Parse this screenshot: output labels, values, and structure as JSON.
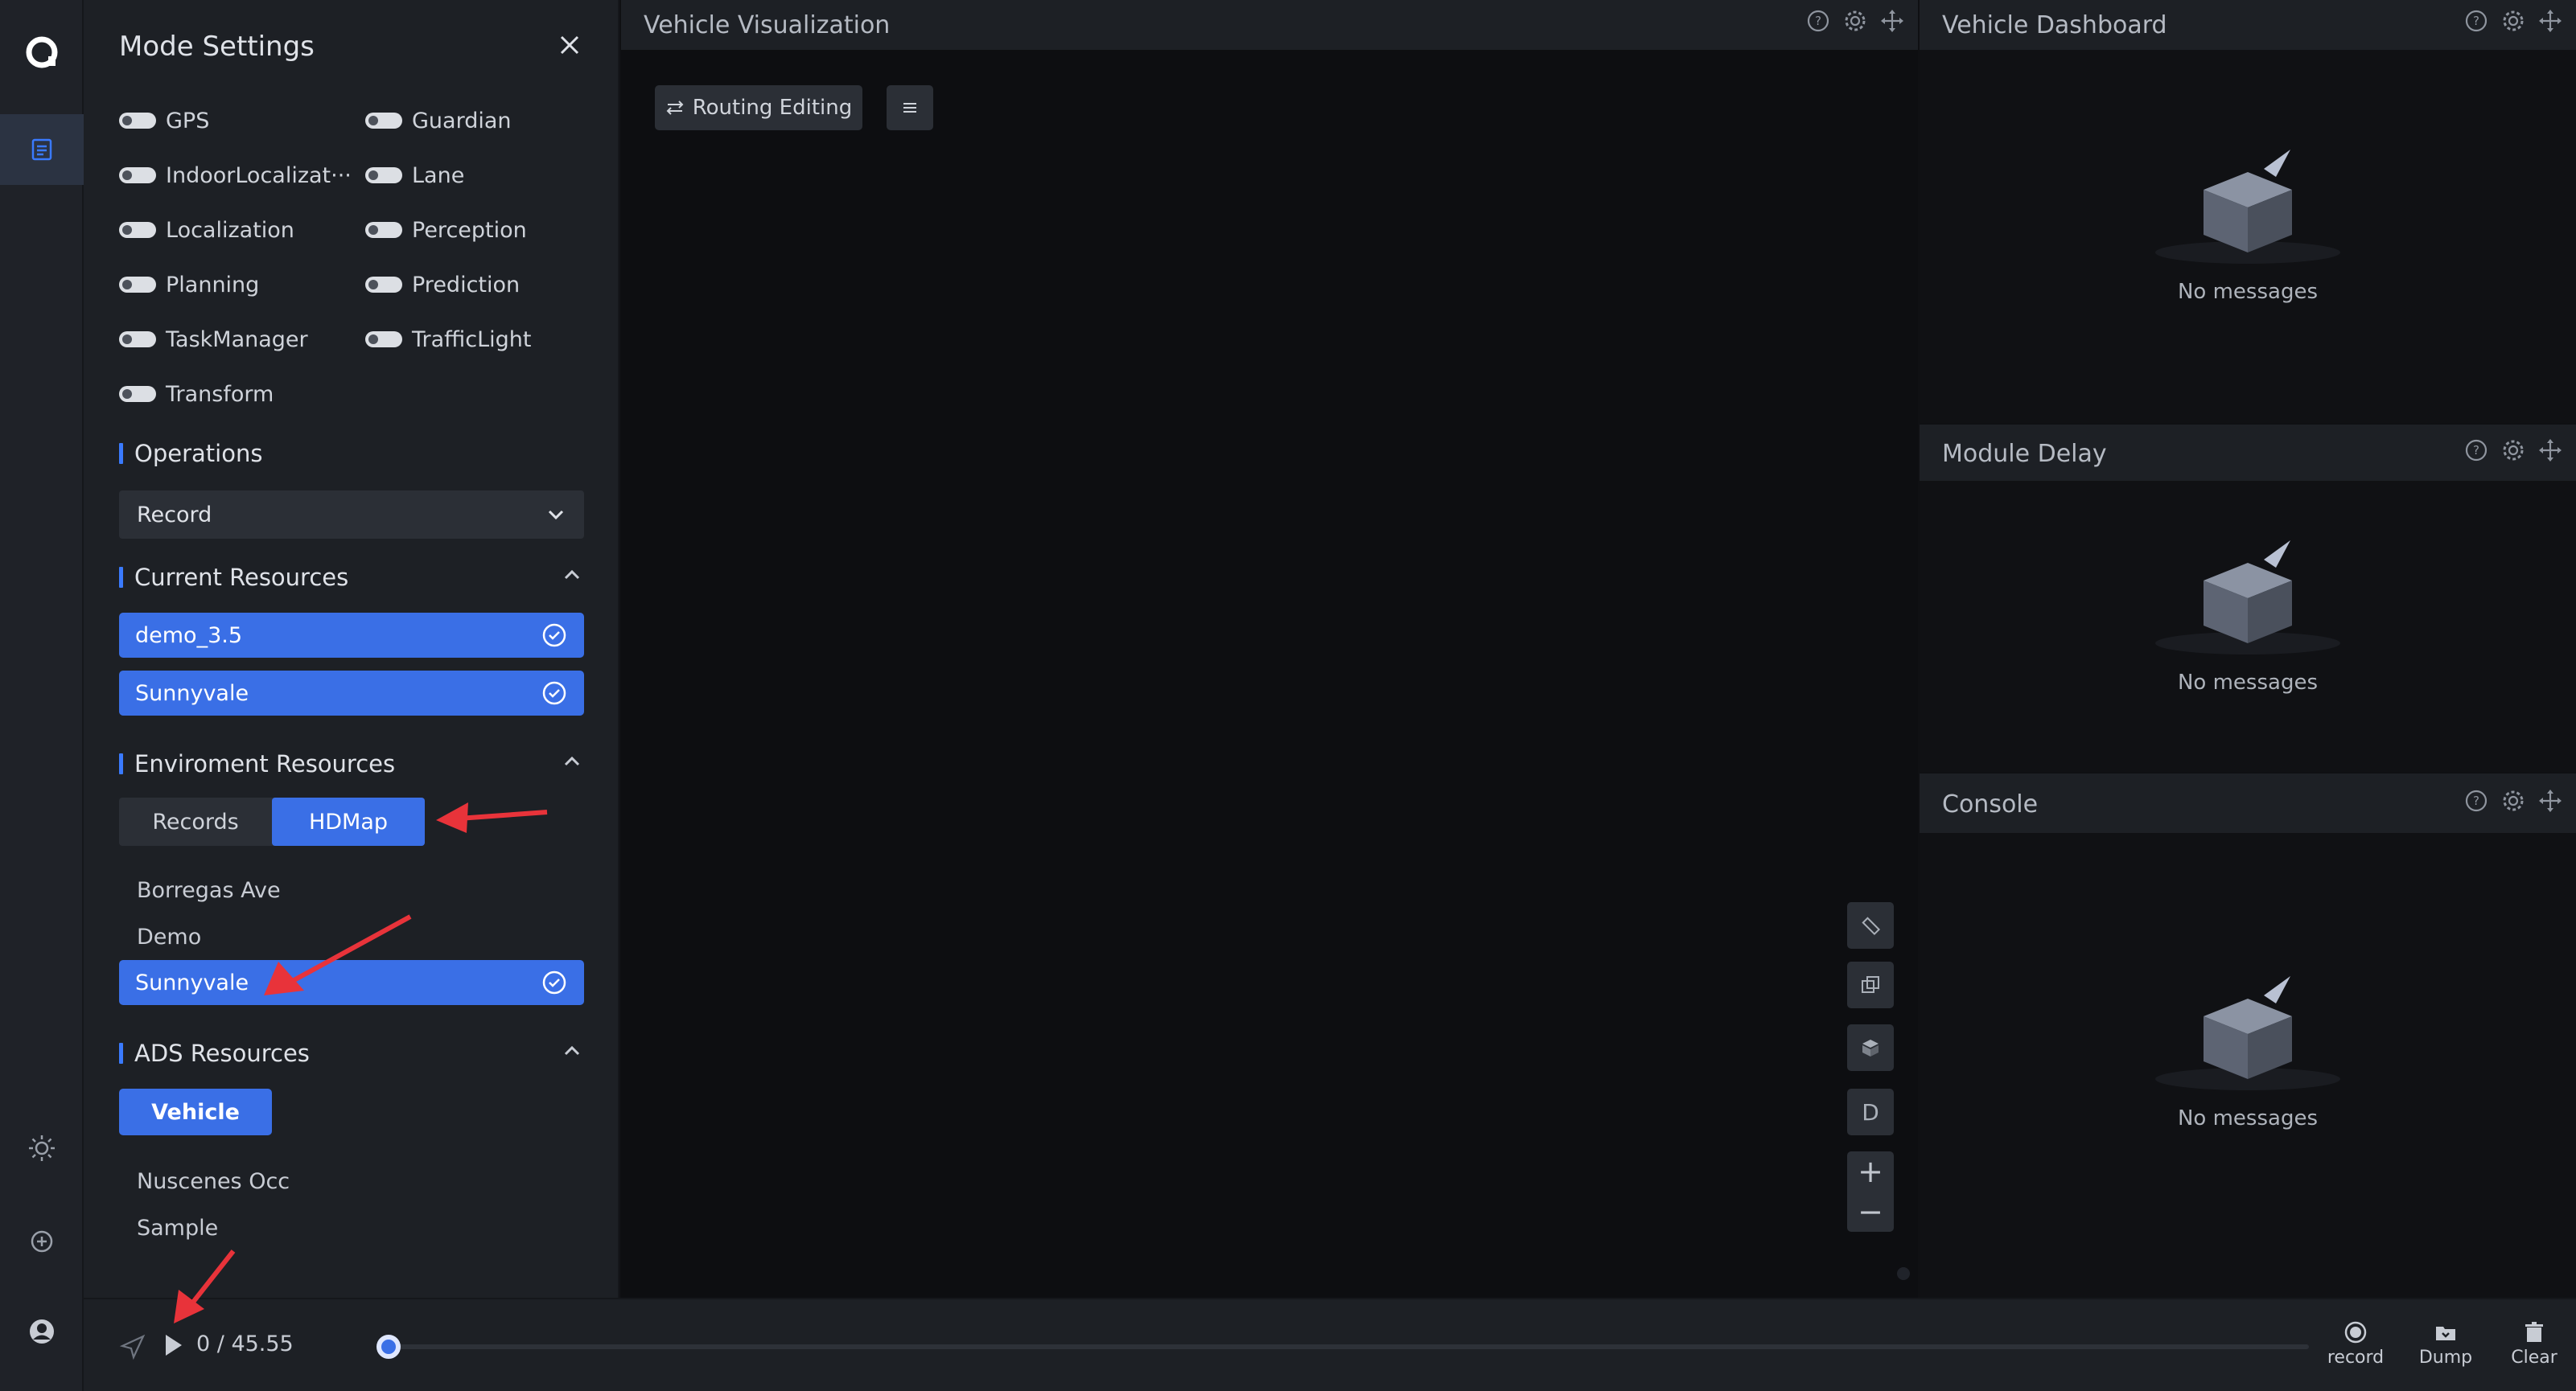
{
  "settings": {
    "title": "Mode Settings",
    "modules": [
      "GPS",
      "Guardian",
      "IndoorLocalizat···",
      "Lane",
      "Localization",
      "Perception",
      "Planning",
      "Prediction",
      "TaskManager",
      "TrafficLight",
      "Transform"
    ],
    "operations_title": "Operations",
    "operations_selected": "Record",
    "current_title": "Current Resources",
    "current_items": [
      "demo_3.5",
      "Sunnyvale"
    ],
    "env_title": "Enviroment Resources",
    "env_tabs": [
      "Records",
      "HDMap"
    ],
    "env_active_tab": "HDMap",
    "env_items": [
      "Borregas Ave",
      "Demo"
    ],
    "env_selected": "Sunnyvale",
    "ads_title": "ADS Resources",
    "ads_button": "Vehicle",
    "ads_items": [
      "Nuscenes Occ",
      "Sample"
    ]
  },
  "viz": {
    "title": "Vehicle Visualization",
    "routing_label": "Routing Editing",
    "tool_d": "D",
    "zoom_in": "+",
    "zoom_out": "−"
  },
  "panels": {
    "dashboard": "Vehicle Dashboard",
    "delay": "Module Delay",
    "console": "Console",
    "empty": "No messages"
  },
  "bottom": {
    "time": "0 / 45.55",
    "record": "record",
    "dump": "Dump",
    "clear": "Clear"
  },
  "colors": {
    "accent": "#3a6fe6",
    "annotation": "#e8333a"
  }
}
